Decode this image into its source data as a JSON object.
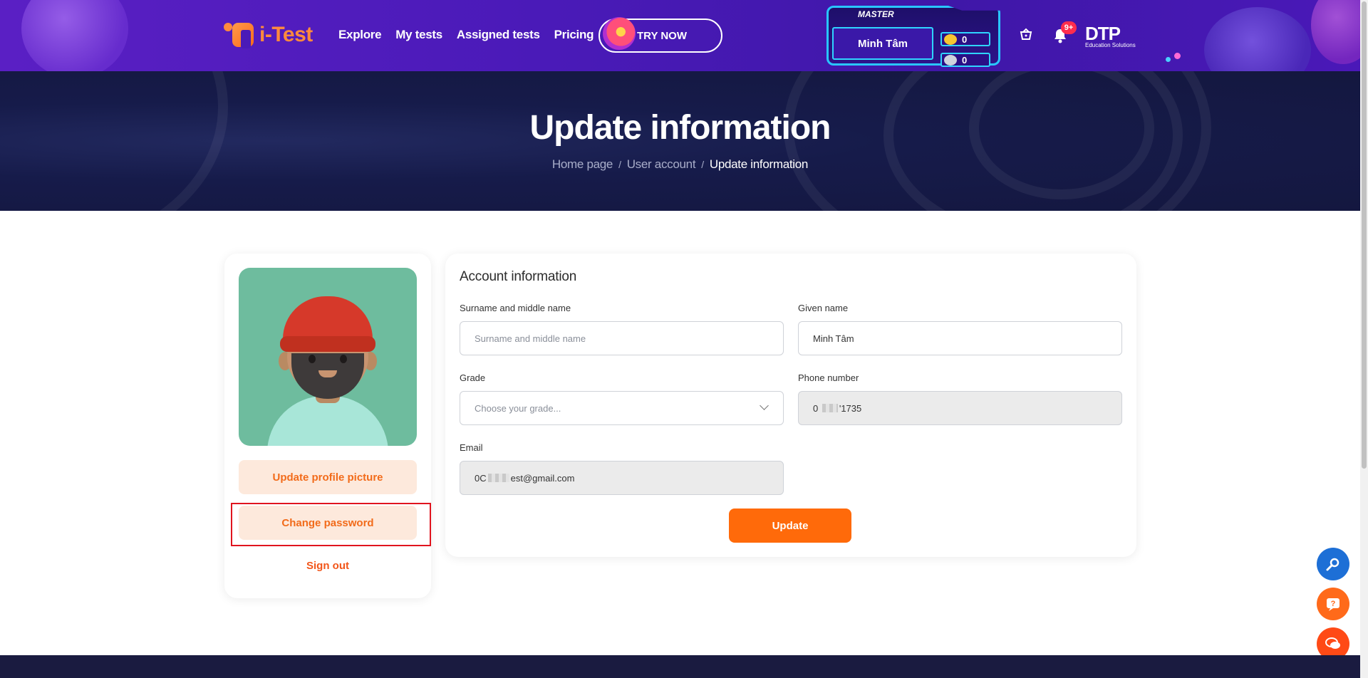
{
  "brand": {
    "logo_text": "i-Test"
  },
  "nav": {
    "items": [
      {
        "label": "Explore"
      },
      {
        "label": "My tests"
      },
      {
        "label": "Assigned tests"
      },
      {
        "label": "Pricing"
      }
    ],
    "try_now": "TRY NOW"
  },
  "user_badge": {
    "rank": "MASTER",
    "name": "Minh Tâm",
    "gold_coins": "0",
    "silver_coins": "0"
  },
  "notifications": {
    "count": "9+"
  },
  "partner_logo": {
    "name": "DTP",
    "tagline": "Education Solutions"
  },
  "hero": {
    "title": "Update information",
    "breadcrumb": [
      {
        "label": "Home page"
      },
      {
        "label": "User account"
      },
      {
        "label": "Update information"
      }
    ]
  },
  "sidebar": {
    "update_picture": "Update profile picture",
    "change_password": "Change password",
    "sign_out": "Sign out"
  },
  "form": {
    "title": "Account information",
    "surname": {
      "label": "Surname and middle name",
      "placeholder": "Surname and middle name",
      "value": ""
    },
    "given_name": {
      "label": "Given name",
      "value": "Minh Tâm"
    },
    "grade": {
      "label": "Grade",
      "placeholder": "Choose your grade..."
    },
    "phone": {
      "label": "Phone number",
      "value_prefix": "0 ",
      "value_suffix": "'1735"
    },
    "email": {
      "label": "Email",
      "value_prefix": "0C",
      "value_suffix": "est@gmail.com"
    },
    "submit": "Update"
  },
  "colors": {
    "primary_orange": "#ff6a0a",
    "nav_purple": "#4a1ab8",
    "hero_navy": "#161b4a",
    "highlight_red": "#e0141e"
  },
  "icons": {
    "cart": "basket-icon",
    "bell": "bell-icon",
    "search_fab": "search-key-icon",
    "help_fab": "question-icon",
    "chat_fab": "chat-icon"
  }
}
